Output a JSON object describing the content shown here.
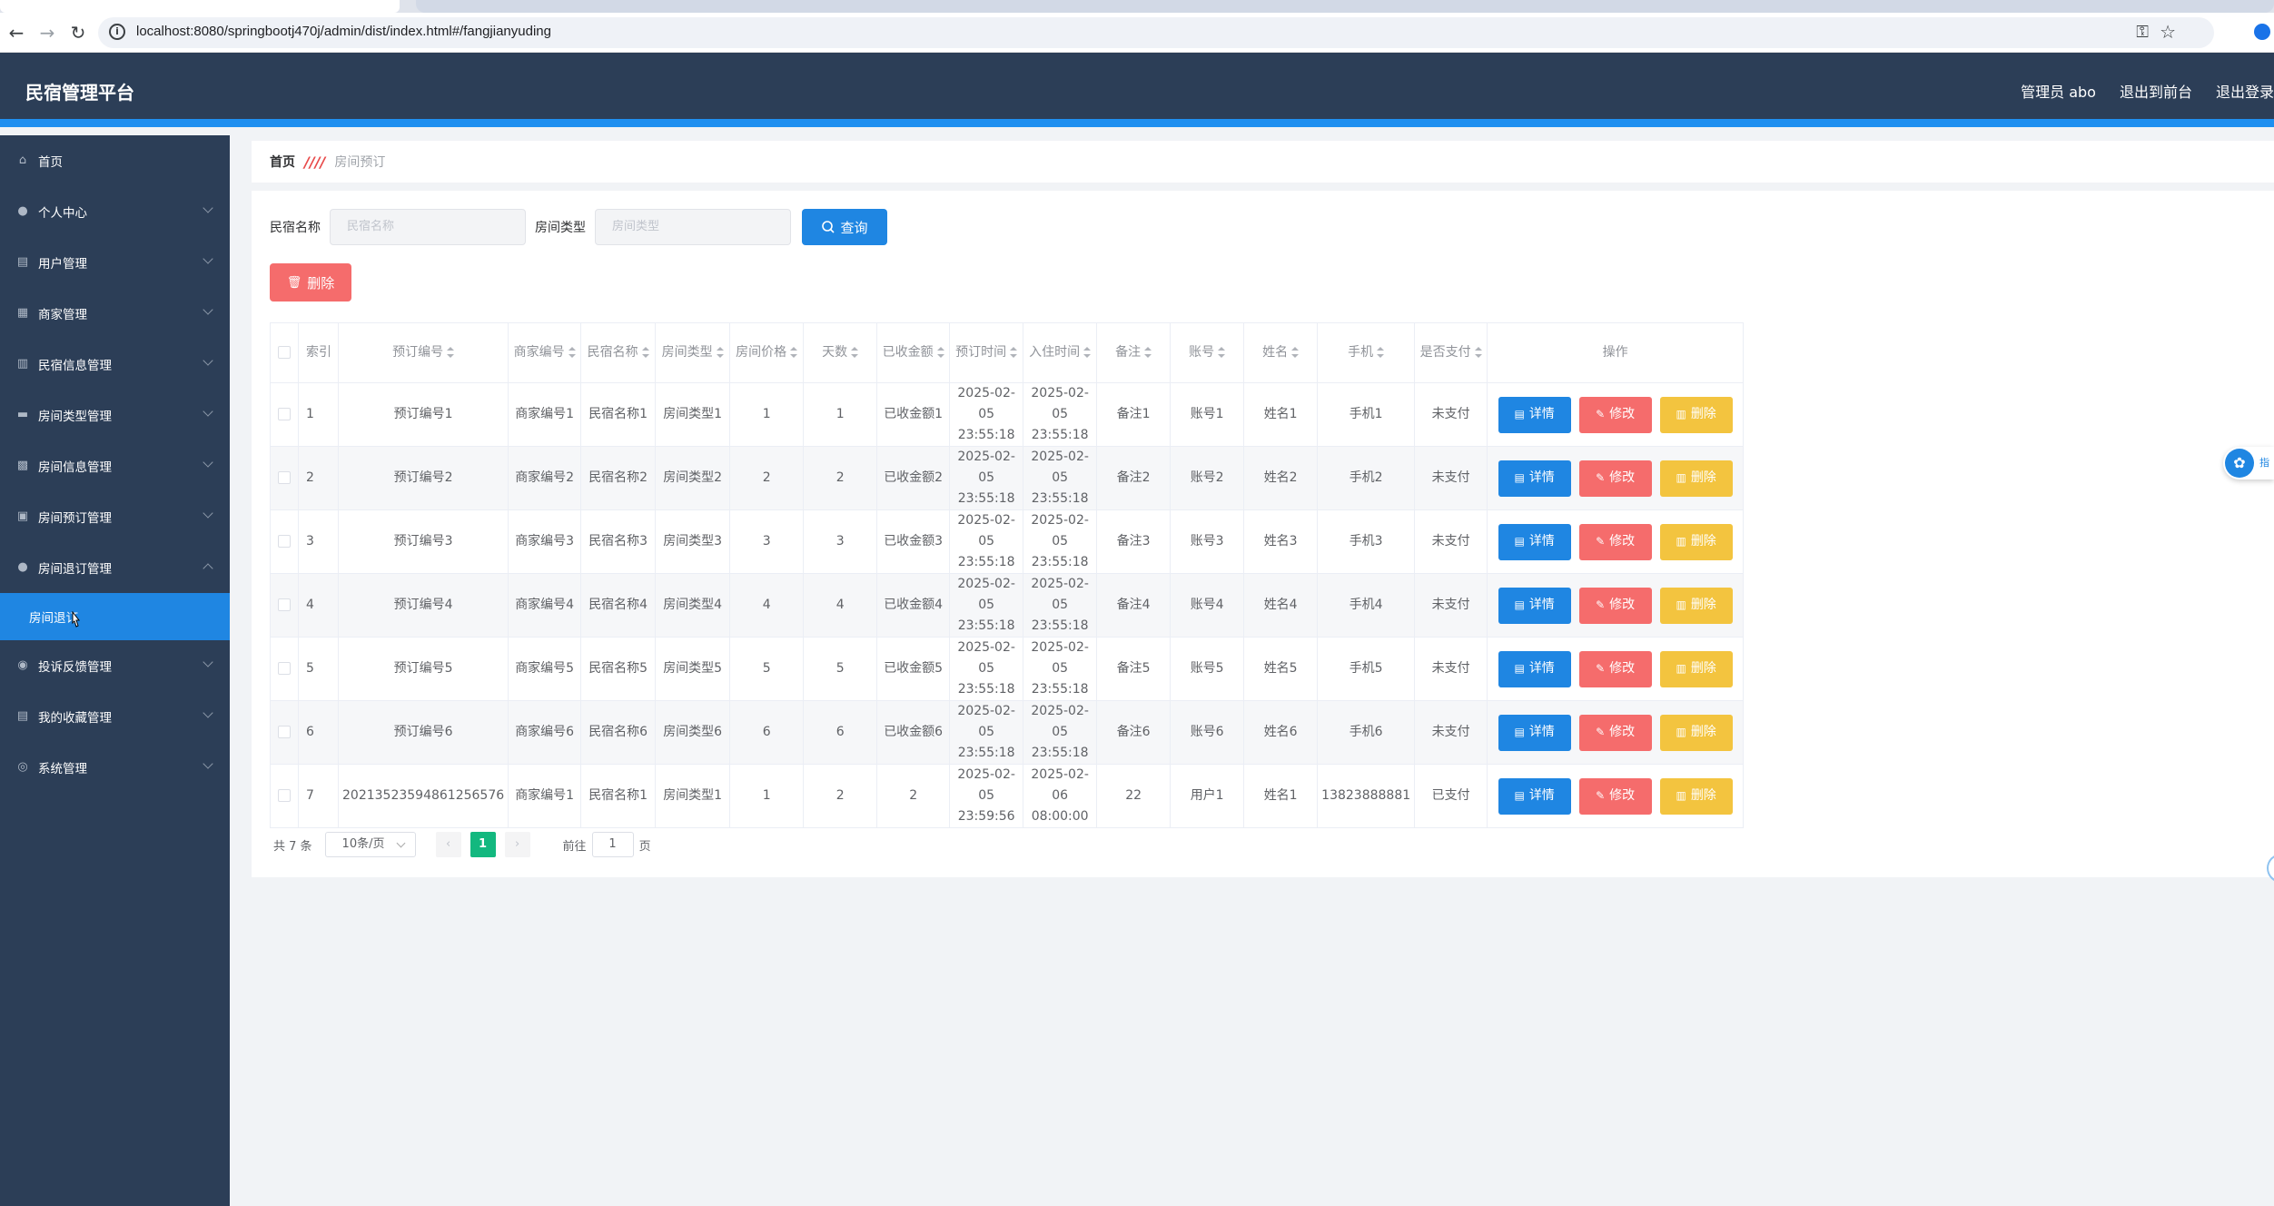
{
  "browser": {
    "url": "localhost:8080/springbootj470j/admin/dist/index.html#/fangjianyuding"
  },
  "header": {
    "title": "民宿管理平台",
    "user": "管理员 abo",
    "to_front": "退出到前台",
    "logout": "退出登录"
  },
  "sidebar": {
    "items": [
      {
        "label": "首页",
        "icon": "home-icon"
      },
      {
        "label": "个人中心",
        "icon": "user-icon"
      },
      {
        "label": "用户管理",
        "icon": "users-icon"
      },
      {
        "label": "商家管理",
        "icon": "store-icon"
      },
      {
        "label": "民宿信息管理",
        "icon": "house-icon"
      },
      {
        "label": "房间类型管理",
        "icon": "bed-icon"
      },
      {
        "label": "房间信息管理",
        "icon": "building-icon"
      },
      {
        "label": "房间预订管理",
        "icon": "calendar-icon"
      },
      {
        "label": "房间退订管理",
        "icon": "person-icon"
      },
      {
        "label": "投诉反馈管理",
        "icon": "feedback-icon"
      },
      {
        "label": "我的收藏管理",
        "icon": "bookmark-icon"
      },
      {
        "label": "系统管理",
        "icon": "settings-icon"
      }
    ],
    "active_sub": "房间退订"
  },
  "breadcrumb": {
    "home": "首页",
    "separator": "////",
    "current": "房间预订"
  },
  "search": {
    "name_label": "民宿名称",
    "name_placeholder": "民宿名称",
    "type_label": "房间类型",
    "type_placeholder": "房间类型",
    "query_btn": "查询",
    "delete_btn": "删除"
  },
  "table": {
    "headers": [
      "索引",
      "预订编号",
      "商家编号",
      "民宿名称",
      "房间类型",
      "房间价格",
      "天数",
      "已收金额",
      "预订时间",
      "入住时间",
      "备注",
      "账号",
      "姓名",
      "手机",
      "是否支付",
      "操作"
    ],
    "rows": [
      [
        "1",
        "预订编号1",
        "商家编号1",
        "民宿名称1",
        "房间类型1",
        "1",
        "1",
        "已收金额1",
        "2025-02-05 23:55:18",
        "2025-02-05 23:55:18",
        "备注1",
        "账号1",
        "姓名1",
        "手机1",
        "未支付"
      ],
      [
        "2",
        "预订编号2",
        "商家编号2",
        "民宿名称2",
        "房间类型2",
        "2",
        "2",
        "已收金额2",
        "2025-02-05 23:55:18",
        "2025-02-05 23:55:18",
        "备注2",
        "账号2",
        "姓名2",
        "手机2",
        "未支付"
      ],
      [
        "3",
        "预订编号3",
        "商家编号3",
        "民宿名称3",
        "房间类型3",
        "3",
        "3",
        "已收金额3",
        "2025-02-05 23:55:18",
        "2025-02-05 23:55:18",
        "备注3",
        "账号3",
        "姓名3",
        "手机3",
        "未支付"
      ],
      [
        "4",
        "预订编号4",
        "商家编号4",
        "民宿名称4",
        "房间类型4",
        "4",
        "4",
        "已收金额4",
        "2025-02-05 23:55:18",
        "2025-02-05 23:55:18",
        "备注4",
        "账号4",
        "姓名4",
        "手机4",
        "未支付"
      ],
      [
        "5",
        "预订编号5",
        "商家编号5",
        "民宿名称5",
        "房间类型5",
        "5",
        "5",
        "已收金额5",
        "2025-02-05 23:55:18",
        "2025-02-05 23:55:18",
        "备注5",
        "账号5",
        "姓名5",
        "手机5",
        "未支付"
      ],
      [
        "6",
        "预订编号6",
        "商家编号6",
        "民宿名称6",
        "房间类型6",
        "6",
        "6",
        "已收金额6",
        "2025-02-05 23:55:18",
        "2025-02-05 23:55:18",
        "备注6",
        "账号6",
        "姓名6",
        "手机6",
        "未支付"
      ],
      [
        "7",
        "20213523594861256576",
        "商家编号1",
        "民宿名称1",
        "房间类型1",
        "1",
        "2",
        "2",
        "2025-02-05 23:59:56",
        "2025-02-06 08:00:00",
        "22",
        "用户1",
        "姓名1",
        "13823888881",
        "已支付"
      ]
    ],
    "actions": {
      "detail": "详情",
      "edit": "修改",
      "delete": "删除"
    }
  },
  "pagination": {
    "total": "共 7 条",
    "page_size": "10条/页",
    "current_page": "1",
    "goto_label": "前往",
    "goto_value": "1",
    "page_unit": "页"
  },
  "float_widget": {
    "text": "指"
  },
  "colors": {
    "header_bg": "#2c3e57",
    "accent": "#1f86e2",
    "danger": "#f56c6c",
    "warning": "#f3c43f",
    "success": "#13b87f"
  }
}
